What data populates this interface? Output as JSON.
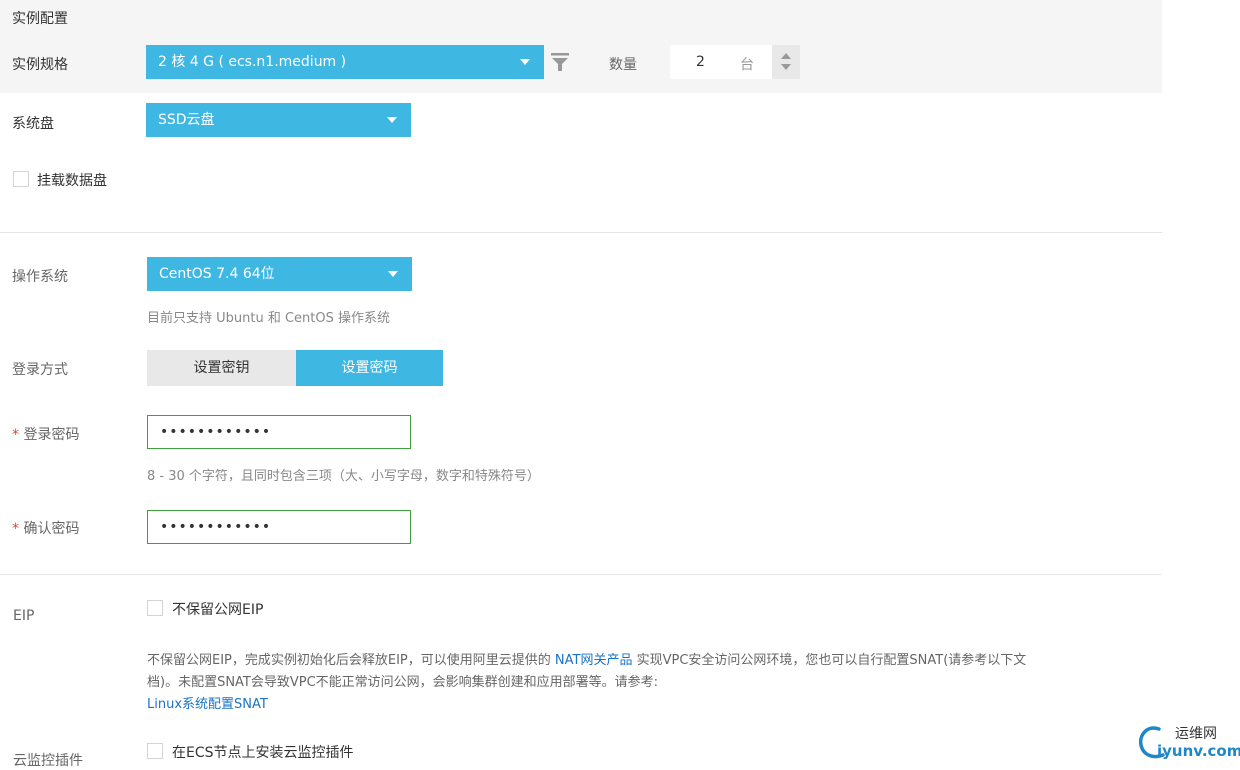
{
  "section": {
    "title": "实例配置"
  },
  "spec": {
    "label": "实例规格",
    "selected": "2 核 4 G ( ecs.n1.medium )",
    "quantity_label": "数量",
    "quantity_value": "2",
    "quantity_unit": "台"
  },
  "system_disk": {
    "label": "系统盘",
    "selected": "SSD云盘"
  },
  "data_disk": {
    "label": "挂载数据盘",
    "checked": false
  },
  "os": {
    "label": "操作系统",
    "selected": "CentOS 7.4 64位",
    "hint": "目前只支持 Ubuntu 和 CentOS 操作系统"
  },
  "login": {
    "label": "登录方式",
    "tabs": [
      {
        "label": "设置密钥",
        "active": false
      },
      {
        "label": "设置密码",
        "active": true
      }
    ]
  },
  "password": {
    "required_mark": "*",
    "label": "登录密码",
    "value": "••••••••••••",
    "hint": "8 - 30 个字符，且同时包含三项（大、小写字母，数字和特殊符号）"
  },
  "confirm_password": {
    "required_mark": "*",
    "label": "确认密码",
    "value": "••••••••••••"
  },
  "eip": {
    "label": "EIP",
    "checkbox_label": "不保留公网EIP",
    "desc_part1": "不保留公网EIP，完成实例初始化后会释放EIP，可以使用阿里云提供的 ",
    "desc_link": "NAT网关产品",
    "desc_part2": " 实现VPC安全访问公网环境，您也可以自行配置SNAT(请参考以下文",
    "desc_line2": "档)。未配置SNAT会导致VPC不能正常访问公网，会影响集群创建和应用部署等。请参考:",
    "snat_link": "Linux系统配置SNAT"
  },
  "monitor": {
    "label": "云监控插件",
    "checkbox_label": "在ECS节点上安装云监控插件"
  },
  "watermark": {
    "line1": "运维网",
    "line2": "iyunv.com"
  },
  "colors": {
    "accent": "#3fb7e3",
    "valid_border": "#3ea03e",
    "link": "#1a73c8",
    "required": "#f04134"
  }
}
